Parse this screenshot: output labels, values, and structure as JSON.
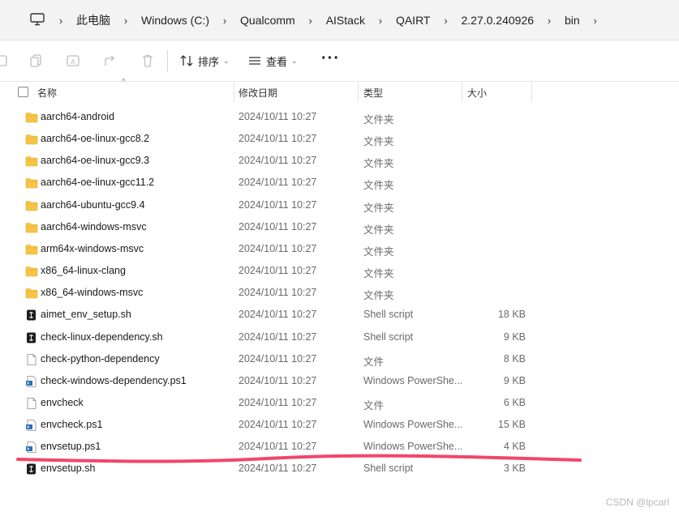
{
  "breadcrumbs": [
    "此电脑",
    "Windows (C:)",
    "Qualcomm",
    "AIStack",
    "QAIRT",
    "2.27.0.240926",
    "bin"
  ],
  "toolbar": {
    "sort_label": "排序",
    "view_label": "查看",
    "more_label": "···"
  },
  "columns": {
    "name": "名称",
    "date": "修改日期",
    "type": "类型",
    "size": "大小"
  },
  "files": [
    {
      "name": "aarch64-android",
      "date": "2024/10/11 10:27",
      "type": "文件夹",
      "size": "",
      "icon": "folder-icon"
    },
    {
      "name": "aarch64-oe-linux-gcc8.2",
      "date": "2024/10/11 10:27",
      "type": "文件夹",
      "size": "",
      "icon": "folder-icon"
    },
    {
      "name": "aarch64-oe-linux-gcc9.3",
      "date": "2024/10/11 10:27",
      "type": "文件夹",
      "size": "",
      "icon": "folder-icon"
    },
    {
      "name": "aarch64-oe-linux-gcc11.2",
      "date": "2024/10/11 10:27",
      "type": "文件夹",
      "size": "",
      "icon": "folder-icon"
    },
    {
      "name": "aarch64-ubuntu-gcc9.4",
      "date": "2024/10/11 10:27",
      "type": "文件夹",
      "size": "",
      "icon": "folder-icon"
    },
    {
      "name": "aarch64-windows-msvc",
      "date": "2024/10/11 10:27",
      "type": "文件夹",
      "size": "",
      "icon": "folder-icon"
    },
    {
      "name": "arm64x-windows-msvc",
      "date": "2024/10/11 10:27",
      "type": "文件夹",
      "size": "",
      "icon": "folder-icon"
    },
    {
      "name": "x86_64-linux-clang",
      "date": "2024/10/11 10:27",
      "type": "文件夹",
      "size": "",
      "icon": "folder-icon"
    },
    {
      "name": "x86_64-windows-msvc",
      "date": "2024/10/11 10:27",
      "type": "文件夹",
      "size": "",
      "icon": "folder-icon"
    },
    {
      "name": "aimet_env_setup.sh",
      "date": "2024/10/11 10:27",
      "type": "Shell script",
      "size": "18 KB",
      "icon": "shell-script-icon"
    },
    {
      "name": "check-linux-dependency.sh",
      "date": "2024/10/11 10:27",
      "type": "Shell script",
      "size": "9 KB",
      "icon": "shell-script-icon"
    },
    {
      "name": "check-python-dependency",
      "date": "2024/10/11 10:27",
      "type": "文件",
      "size": "8 KB",
      "icon": "file-icon"
    },
    {
      "name": "check-windows-dependency.ps1",
      "date": "2024/10/11 10:27",
      "type": "Windows PowerShe...",
      "size": "9 KB",
      "icon": "powershell-icon"
    },
    {
      "name": "envcheck",
      "date": "2024/10/11 10:27",
      "type": "文件",
      "size": "6 KB",
      "icon": "file-icon"
    },
    {
      "name": "envcheck.ps1",
      "date": "2024/10/11 10:27",
      "type": "Windows PowerShe...",
      "size": "15 KB",
      "icon": "powershell-icon"
    },
    {
      "name": "envsetup.ps1",
      "date": "2024/10/11 10:27",
      "type": "Windows PowerShe...",
      "size": "4 KB",
      "icon": "powershell-icon"
    },
    {
      "name": "envsetup.sh",
      "date": "2024/10/11 10:27",
      "type": "Shell script",
      "size": "3 KB",
      "icon": "shell-script-icon"
    }
  ],
  "watermark": "CSDN @lpcarl",
  "colors": {
    "folder": "#f5c54a",
    "folder_dark": "#e8ad24",
    "annotation": "#f2466a",
    "powershell": "#2b6fb8"
  }
}
